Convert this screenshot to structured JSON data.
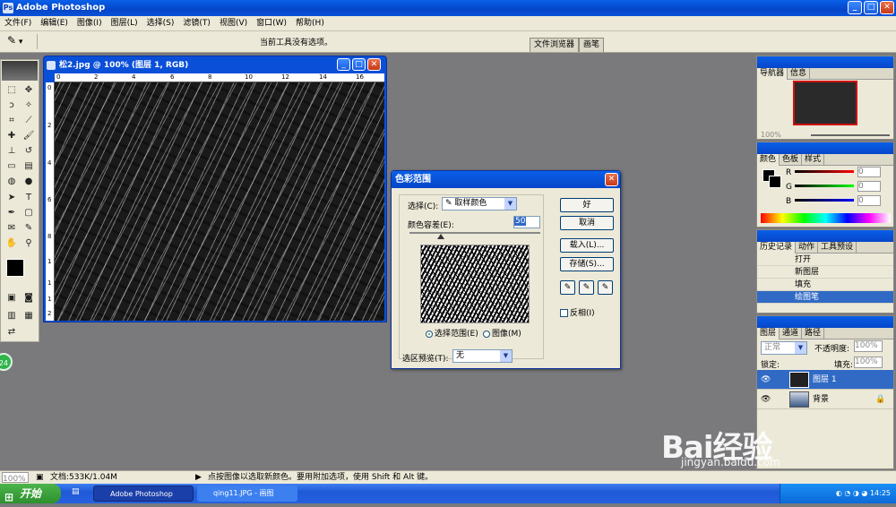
{
  "app": {
    "title": "Adobe Photoshop"
  },
  "menu": [
    "文件(F)",
    "编辑(E)",
    "图像(I)",
    "图层(L)",
    "选择(S)",
    "滤镜(T)",
    "视图(V)",
    "窗口(W)",
    "帮助(H)"
  ],
  "options": {
    "hint": "当前工具没有选项。",
    "tab_browser": "文件浏览器",
    "tab_brush": "画笔"
  },
  "document": {
    "title": "松2.jpg @ 100% (图层 1, RGB)",
    "ruler_h": [
      "0",
      "2",
      "4",
      "6",
      "8",
      "10",
      "12",
      "14",
      "16"
    ],
    "ruler_v": [
      "0",
      "2",
      "4",
      "6",
      "8",
      "1",
      "1",
      "1",
      "2"
    ]
  },
  "dialog": {
    "title": "色彩范围",
    "select_label": "选择(C):",
    "select_value": "取样颜色",
    "tolerance_label": "颜色容差(E):",
    "tolerance_value": "50",
    "radio_selection": "选择范围(E)",
    "radio_image": "图像(M)",
    "preview_label": "选区预览(T):",
    "preview_value": "无",
    "ok": "好",
    "cancel": "取消",
    "load": "载入(L)...",
    "save": "存储(S)...",
    "invert": "反相(I)"
  },
  "palettes": {
    "navigator": {
      "tabs": [
        "导航器",
        "信息"
      ],
      "zoom": "100%"
    },
    "color": {
      "tabs": [
        "颜色",
        "色板",
        "样式"
      ],
      "channels": [
        "R",
        "G",
        "B"
      ],
      "values": [
        "0",
        "0",
        "0"
      ]
    },
    "history": {
      "tabs": [
        "历史记录",
        "动作",
        "工具预设"
      ],
      "items": [
        "打开",
        "新图层",
        "填充",
        "绘图笔"
      ]
    },
    "layers": {
      "tabs": [
        "图层",
        "通道",
        "路径"
      ],
      "mode": "正常",
      "opacity_label": "不透明度:",
      "opacity": "100%",
      "lock_label": "锁定:",
      "fill_label": "填充:",
      "fill": "100%",
      "items": [
        "图层 1",
        "背景"
      ]
    }
  },
  "status": {
    "zoom": "100%",
    "doc": "文档:533K/1.04M",
    "hint": "点按图像以选取新颜色。要用附加选项，使用 Shift 和 Alt 键。"
  },
  "taskbar": {
    "start": "开始",
    "tasks": [
      "Adobe Photoshop",
      "qing11.JPG - 画图"
    ],
    "clock": "14:25"
  },
  "watermark": {
    "brand": "Bai经验",
    "url": "jingyan.baidu.com"
  },
  "badge": "24"
}
